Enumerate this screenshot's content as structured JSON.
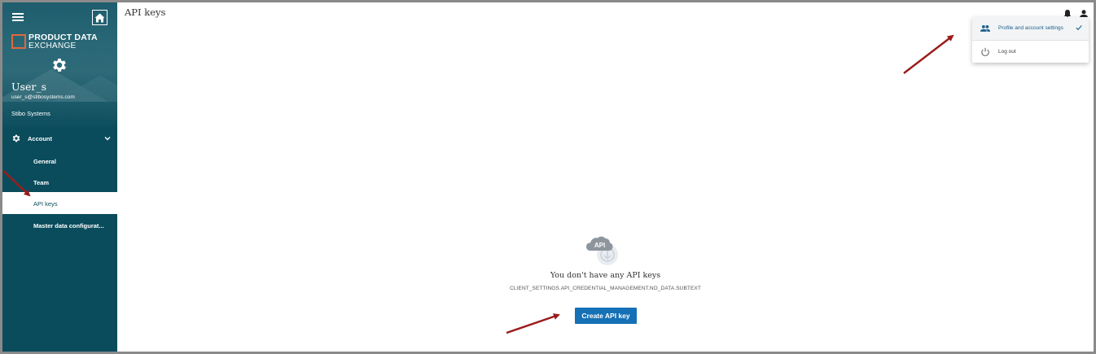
{
  "page": {
    "title": "API keys"
  },
  "sidebar": {
    "brand_line1": "PRODUCT DATA",
    "brand_line2": "EXCHANGE",
    "user_name": "User_s",
    "user_email": "user_s@stibosystems.com",
    "company": "Stibo Systems",
    "group_label": "Account",
    "items": [
      {
        "label": "General"
      },
      {
        "label": "Team"
      },
      {
        "label": "API keys",
        "active": true
      },
      {
        "label": "Master data configurat..."
      }
    ]
  },
  "user_menu": {
    "items": [
      {
        "label": "Profile and account settings",
        "selected": true
      },
      {
        "label": "Log out"
      }
    ]
  },
  "empty_state": {
    "icon_text": "API",
    "title": "You don't have any API keys",
    "subtitle": "CLIENT_SETTINGS.API_CREDENTIAL_MANAGEMENT.NO_DATA.SUBTEXT",
    "button_label": "Create API key"
  },
  "colors": {
    "sidebar_bg": "#0a4c5c",
    "brand_accent": "#e2683c",
    "primary_button": "#1670b5",
    "annotation_arrow": "#9b1c1c"
  },
  "icons": [
    "menu-icon",
    "home-icon",
    "gear-icon",
    "chevron-down-icon",
    "bell-icon",
    "user-icon",
    "people-icon",
    "check-icon",
    "power-icon",
    "api-cloud-icon"
  ]
}
